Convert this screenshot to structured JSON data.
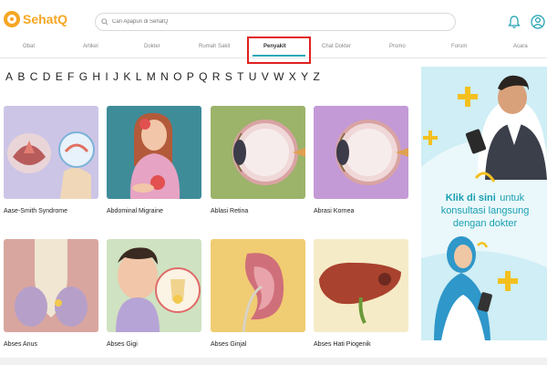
{
  "header": {
    "logo_text": "SehatQ",
    "search_placeholder": "Cari Apapun di SehatQ",
    "icons": [
      "bell-icon",
      "user-icon"
    ]
  },
  "nav": {
    "items": [
      {
        "label": "Obat"
      },
      {
        "label": "Artikel"
      },
      {
        "label": "Dokter"
      },
      {
        "label": "Rumah Sakit"
      },
      {
        "label": "Penyakit"
      },
      {
        "label": "Chat Dokter"
      },
      {
        "label": "Promo"
      },
      {
        "label": "Forum"
      },
      {
        "label": "Acara"
      }
    ],
    "active": "Penyakit"
  },
  "alphabet": [
    "A",
    "B",
    "C",
    "D",
    "E",
    "F",
    "G",
    "H",
    "I",
    "J",
    "K",
    "L",
    "M",
    "N",
    "O",
    "P",
    "Q",
    "R",
    "S",
    "T",
    "U",
    "V",
    "W",
    "X",
    "Y",
    "Z"
  ],
  "diseases": [
    {
      "label": "Aase-Smith Syndrome"
    },
    {
      "label": "Abdominal Migraine"
    },
    {
      "label": "Ablasi Retina"
    },
    {
      "label": "Abrasi Kornea"
    },
    {
      "label": "Abses Anus"
    },
    {
      "label": "Abses Gigi"
    },
    {
      "label": "Abses Ginjal"
    },
    {
      "label": "Abses Hati Piogenik"
    }
  ],
  "ad": {
    "line1_bold": "Klik di sini",
    "line1_rest": "untuk",
    "line2": "konsultasi langsung",
    "line3": "dengan dokter"
  },
  "colors": {
    "brand": "#f6a623",
    "accent": "#2aa8b8",
    "highlight": "#e02020"
  }
}
